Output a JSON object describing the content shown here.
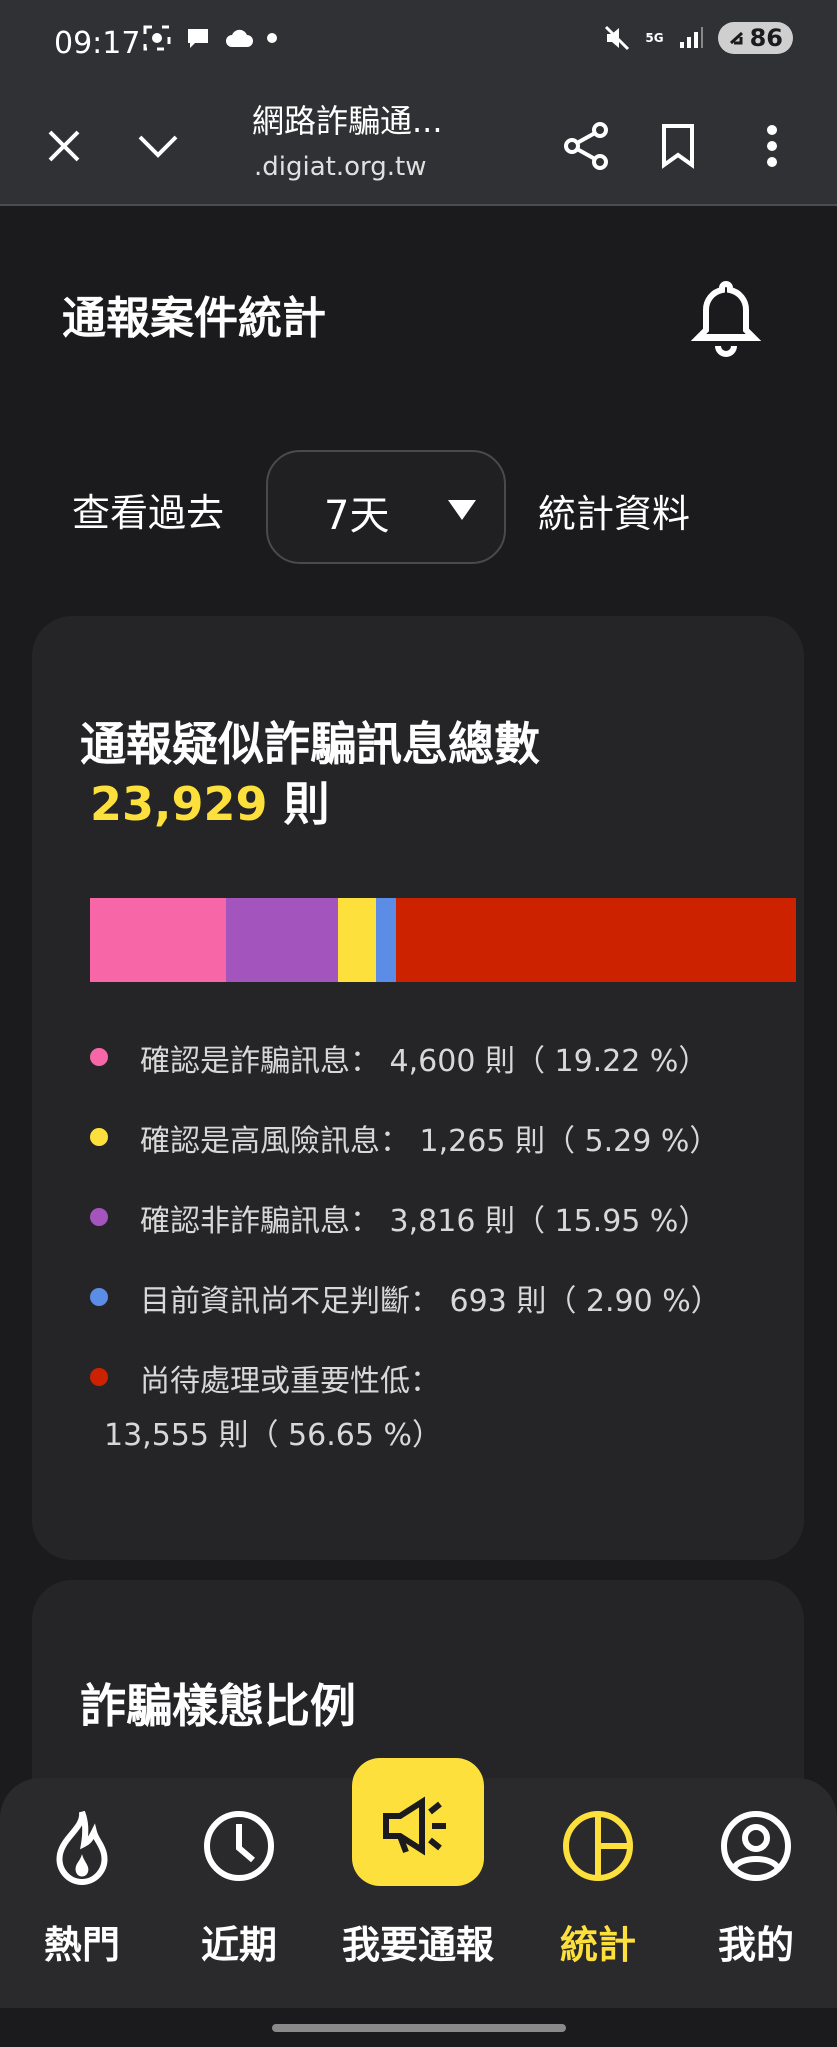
{
  "status_bar": {
    "time": "09:17",
    "network": "5G",
    "battery": "86",
    "icons": [
      "screenshot-icon",
      "chat-icon",
      "cloud-icon",
      "dot-icon",
      "mute-icon",
      "signal-icon",
      "battery-icon"
    ]
  },
  "browser": {
    "title": "網路詐騙通...",
    "url": ".digiat.org.tw",
    "icons": [
      "close-icon",
      "chevron-down-icon",
      "share-icon",
      "bookmark-icon",
      "more-icon"
    ]
  },
  "page": {
    "title": "通報案件統計",
    "range_prefix": "查看過去",
    "range_value": "7天",
    "range_suffix": "統計資料"
  },
  "summary": {
    "title": "通報疑似詐騙訊息總數",
    "total": "23,929",
    "unit": "則",
    "items": [
      {
        "label": "確認是詐騙訊息：",
        "count": "4,600",
        "unit": "則",
        "pct": "19.22",
        "color": "#f767a7",
        "value": 19.22
      },
      {
        "label": "確認是高風險訊息：",
        "count": "1,265",
        "unit": "則",
        "pct": "5.29",
        "color": "#fde03b",
        "value": 5.29
      },
      {
        "label": "確認非詐騙訊息：",
        "count": "3,816",
        "unit": "則",
        "pct": "15.95",
        "color": "#a355bd",
        "value": 15.95
      },
      {
        "label": "目前資訊尚不足判斷：",
        "count": "693",
        "unit": "則",
        "pct": "2.90",
        "color": "#5b8ce6",
        "value": 2.9
      },
      {
        "label": "尚待處理或重要性低：",
        "count": "13,555",
        "unit": "則",
        "pct": "56.65",
        "color": "#cc2200",
        "value": 56.65
      }
    ]
  },
  "section2": {
    "title": "詐騙樣態比例"
  },
  "nav": {
    "items": [
      {
        "label": "熱門",
        "icon": "fire-icon"
      },
      {
        "label": "近期",
        "icon": "clock-icon"
      },
      {
        "label": "我要通報",
        "icon": "megaphone-icon"
      },
      {
        "label": "統計",
        "icon": "pie-chart-icon"
      },
      {
        "label": "我的",
        "icon": "user-icon"
      }
    ],
    "active_color": "#fde03b"
  }
}
